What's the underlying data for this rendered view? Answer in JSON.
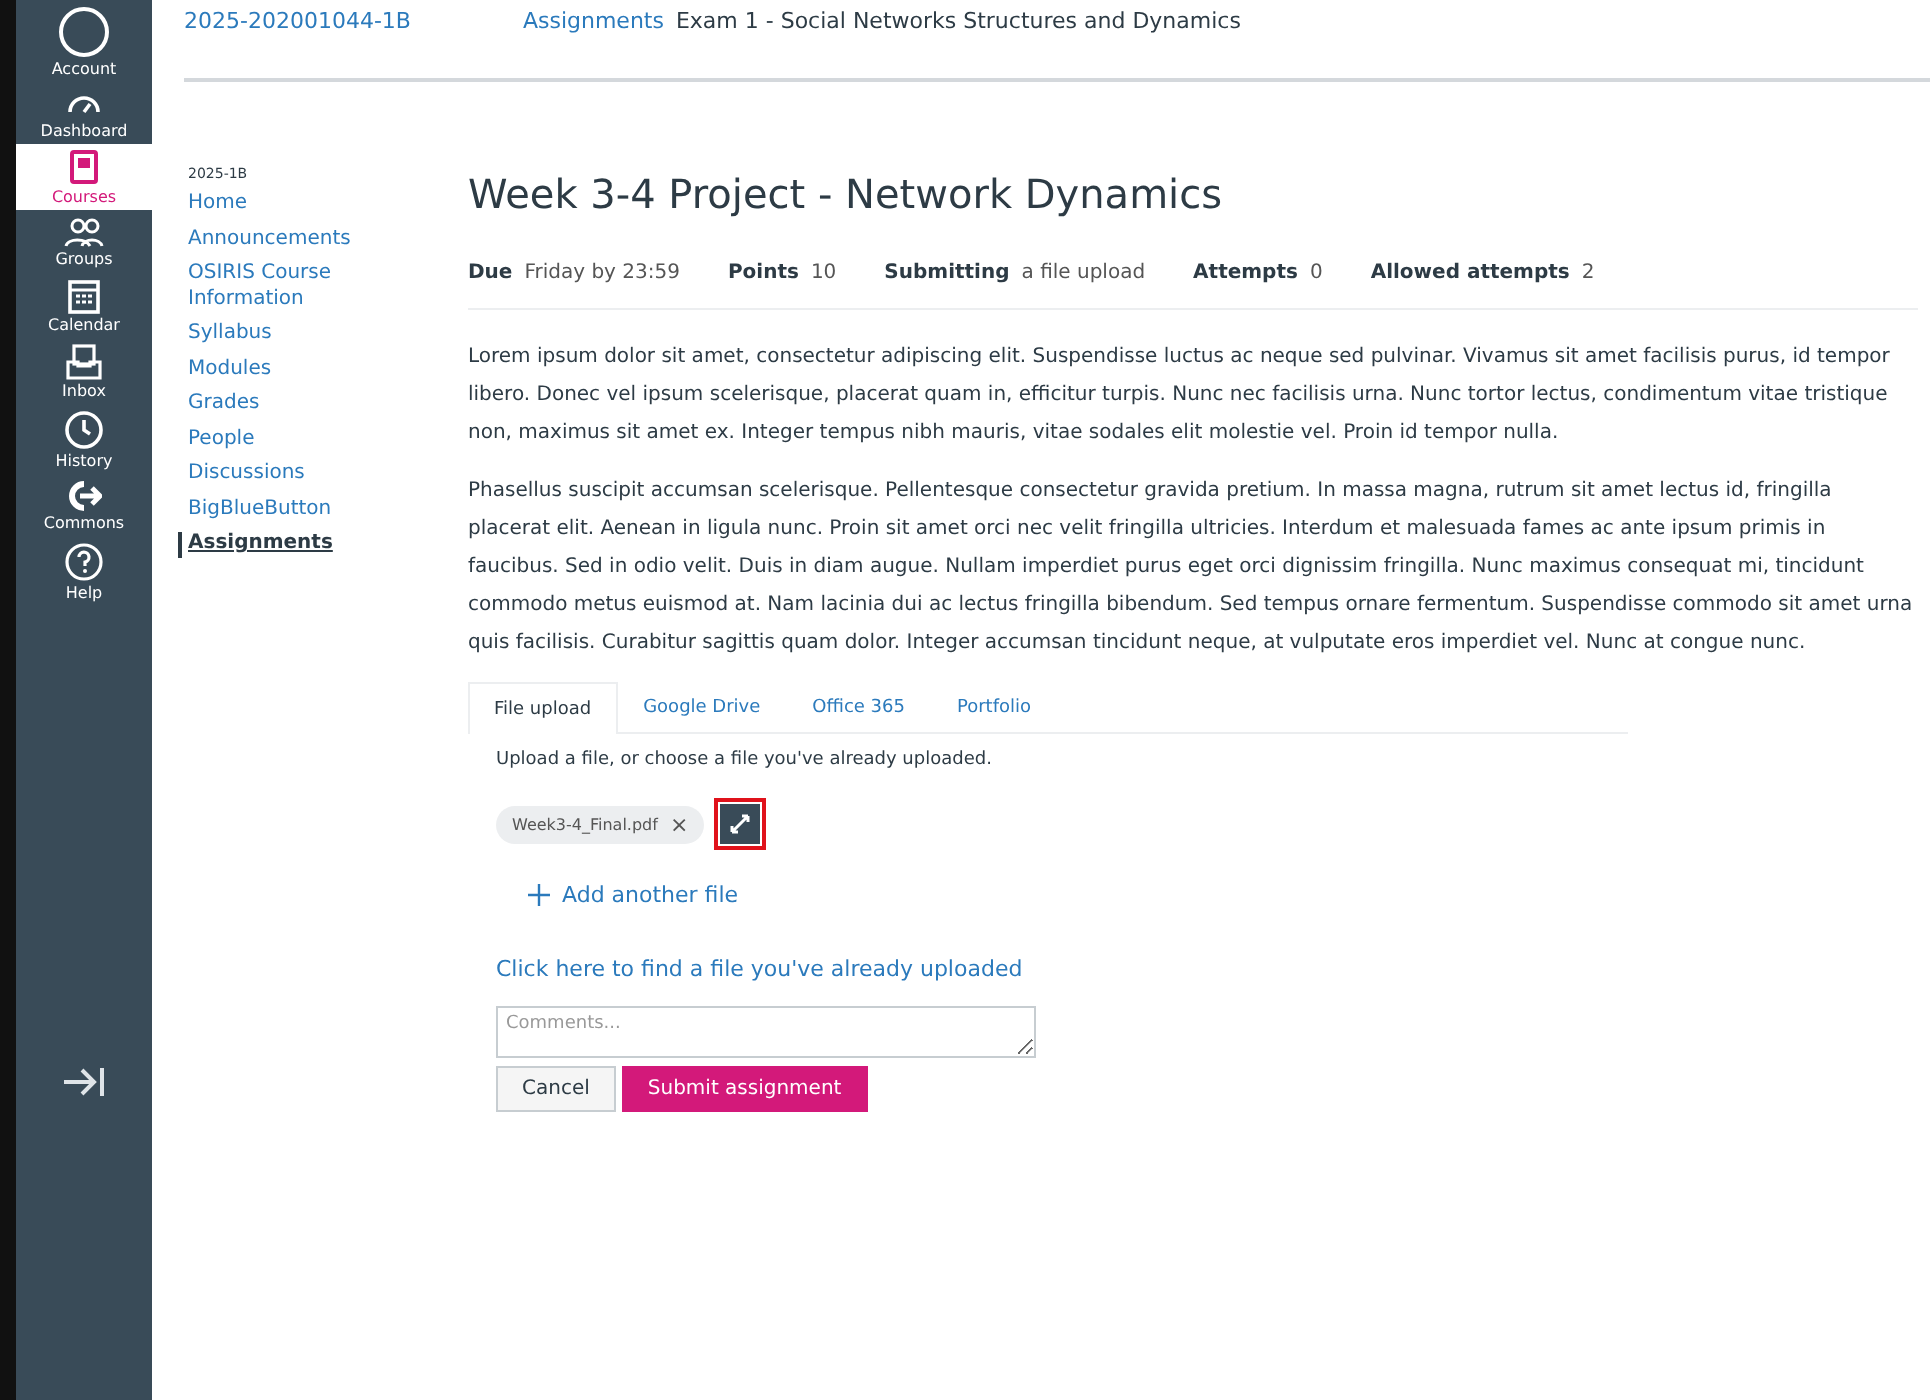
{
  "global_nav": {
    "items": [
      {
        "label": "Account",
        "selected": false
      },
      {
        "label": "Dashboard",
        "selected": false
      },
      {
        "label": "Courses",
        "selected": true
      },
      {
        "label": "Groups",
        "selected": false
      },
      {
        "label": "Calendar",
        "selected": false
      },
      {
        "label": "Inbox",
        "selected": false
      },
      {
        "label": "History",
        "selected": false
      },
      {
        "label": "Commons",
        "selected": false
      },
      {
        "label": "Help",
        "selected": false
      }
    ]
  },
  "breadcrumbs": [
    {
      "text": "2025-202001044-1B",
      "kind": "link"
    },
    {
      "text": "Assignments",
      "kind": "link"
    },
    {
      "text": "Exam 1 - Social Networks Structures and Dynamics",
      "kind": "current"
    }
  ],
  "course_nav": {
    "term": "2025-1B",
    "items": [
      {
        "label": "Home",
        "selected": false
      },
      {
        "label": "Announcements",
        "selected": false
      },
      {
        "label": "OSIRIS Course Information",
        "selected": false
      },
      {
        "label": "Syllabus",
        "selected": false
      },
      {
        "label": "Modules",
        "selected": false
      },
      {
        "label": "Grades",
        "selected": false
      },
      {
        "label": "People",
        "selected": false
      },
      {
        "label": "Discussions",
        "selected": false
      },
      {
        "label": "BigBlueButton",
        "selected": false
      },
      {
        "label": "Assignments",
        "selected": true
      }
    ]
  },
  "assignment": {
    "title": "Week 3-4 Project - Network Dynamics",
    "details": [
      {
        "label": "Due",
        "value": "Friday by 23:59"
      },
      {
        "label": "Points",
        "value": "10"
      },
      {
        "label": "Submitting",
        "value": "a file upload"
      },
      {
        "label": "Attempts",
        "value": "0"
      },
      {
        "label": "Allowed attempts",
        "value": "2"
      }
    ],
    "paragraphs": [
      "Lorem ipsum dolor sit amet, consectetur adipiscing elit. Suspendisse luctus ac neque sed pulvinar. Vivamus sit amet facilisis purus, id tempor libero. Donec vel ipsum scelerisque, placerat quam in, efficitur turpis. Nunc nec facilisis urna. Nunc tortor lectus, condimentum vitae tristique non, maximus sit amet ex. Integer tempus nibh mauris, vitae sodales elit molestie vel. Proin id tempor nulla.",
      "Phasellus suscipit accumsan scelerisque. Pellentesque consectetur gravida pretium. In massa magna, rutrum sit amet lectus id, fringilla placerat elit. Aenean in ligula nunc. Proin sit amet orci nec velit fringilla ultricies. Interdum et malesuada fames ac ante ipsum primis in faucibus. Sed in odio velit. Duis in diam augue. Nullam imperdiet purus eget orci dignissim fringilla. Nunc maximus consequat mi, tincidunt commodo metus euismod at. Nam lacinia dui ac lectus fringilla bibendum. Sed tempus ornare fermentum. Suspendisse commodo sit amet urna quis facilisis. Curabitur sagittis quam dolor. Integer accumsan tincidunt neque, at vulputate eros imperdiet vel. Nunc at congue nunc."
    ]
  },
  "submission": {
    "tabs": [
      {
        "label": "File upload",
        "selected": true
      },
      {
        "label": "Google Drive",
        "selected": false
      },
      {
        "label": "Office 365",
        "selected": false
      },
      {
        "label": "Portfolio",
        "selected": false
      }
    ],
    "instruction": "Upload a file, or choose a file you've already uploaded.",
    "file": {
      "name": "Week3-4_Final.pdf",
      "remove": "×",
      "highlighted": true
    },
    "add_file": "Add another file",
    "find_link": "Click here to find a file you've already uploaded",
    "comments": {
      "placeholder": "Comments..."
    },
    "buttons": [
      {
        "label": "Cancel",
        "kind": "secondary"
      },
      {
        "label": "Submit assignment",
        "kind": "primary"
      }
    ]
  }
}
